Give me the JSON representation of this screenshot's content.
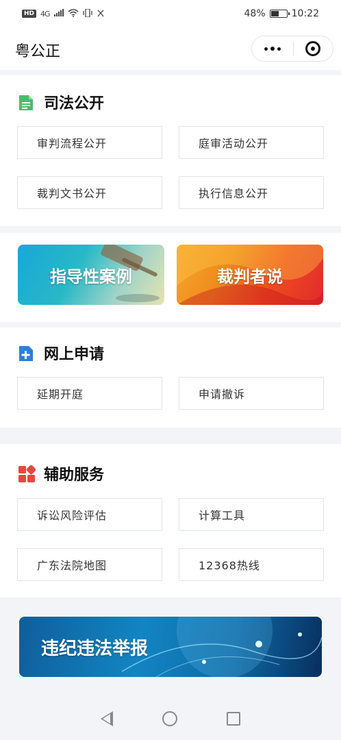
{
  "status_bar": {
    "hd": "HD",
    "network": "4G",
    "battery_percent": "48%",
    "battery_level": 0.48,
    "time": "10:22"
  },
  "nav": {
    "title": "粤公正"
  },
  "sections": {
    "judicial_open": {
      "title": "司法公开",
      "icon": "document-icon",
      "icon_color": "#4dbb6b",
      "items": [
        "审判流程公开",
        "庭审活动公开",
        "裁判文书公开",
        "执行信息公开"
      ]
    },
    "banners": {
      "guide": "指导性案例",
      "judge": "裁判者说"
    },
    "online_apply": {
      "title": "网上申请",
      "icon": "plus-document-icon",
      "icon_color": "#2f7de1",
      "items": [
        "延期开庭",
        "申请撤诉"
      ]
    },
    "aux_services": {
      "title": "辅助服务",
      "icon": "apps-icon",
      "icon_color": "#e8473f",
      "items": [
        "诉讼风险评估",
        "计算工具",
        "广东法院地图",
        "12368热线"
      ]
    },
    "report_banner": "违纪违法举报"
  }
}
